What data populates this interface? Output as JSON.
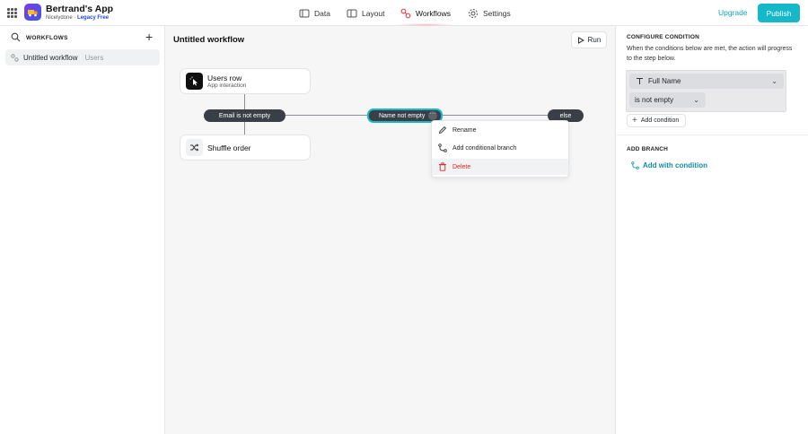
{
  "app": {
    "name": "Bertrand's App",
    "workspace": "Nicelydone",
    "separator": " · ",
    "plan": "Legacy Free"
  },
  "nav": {
    "items": [
      {
        "label": "Data",
        "icon": "database-icon"
      },
      {
        "label": "Layout",
        "icon": "layout-icon"
      },
      {
        "label": "Workflows",
        "icon": "workflows-icon",
        "active": true
      },
      {
        "label": "Settings",
        "icon": "gear-icon"
      }
    ]
  },
  "header": {
    "upgrade_label": "Upgrade",
    "publish_label": "Publish"
  },
  "sidebar": {
    "title": "WORKFLOWS",
    "items": [
      {
        "label": "Untitled workflow",
        "secondary": "Users"
      }
    ]
  },
  "canvas": {
    "title": "Untitled workflow",
    "run_label": "Run",
    "trigger": {
      "title": "Users row",
      "subtitle": "App interaction"
    },
    "branches": [
      "Email is not empty",
      "Name not empty",
      "else"
    ],
    "action": {
      "title": "Shuffle order"
    },
    "context_menu": [
      "Rename",
      "Add conditional branch",
      "Delete"
    ]
  },
  "panel": {
    "configure_title": "CONFIGURE CONDITION",
    "description": "When the conditions below are met, the action will progress to the step below.",
    "condition": {
      "field": "Full Name",
      "operator": "is not empty"
    },
    "add_condition_label": "Add condition",
    "add_branch_title": "ADD BRANCH",
    "add_with_condition_label": "Add with condition"
  },
  "colors": {
    "accent": "#14b8c9",
    "danger": "#dc2626",
    "pill": "#3a3f47"
  }
}
